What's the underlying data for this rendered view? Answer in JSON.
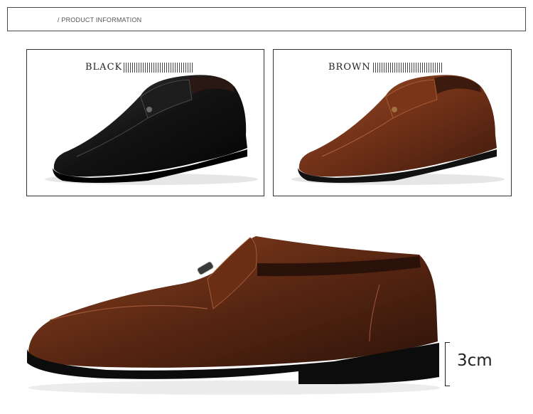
{
  "header": {
    "title": "/ PRODUCT INFORMATION"
  },
  "variants": [
    {
      "label": "BLACK",
      "color": "#121212"
    },
    {
      "label": "BROWN",
      "color": "#6b2e17"
    }
  ],
  "detail": {
    "color": "#5a2712",
    "heel_height": "3cm"
  },
  "icons": {
    "heel_bracket": "bracket-icon"
  }
}
